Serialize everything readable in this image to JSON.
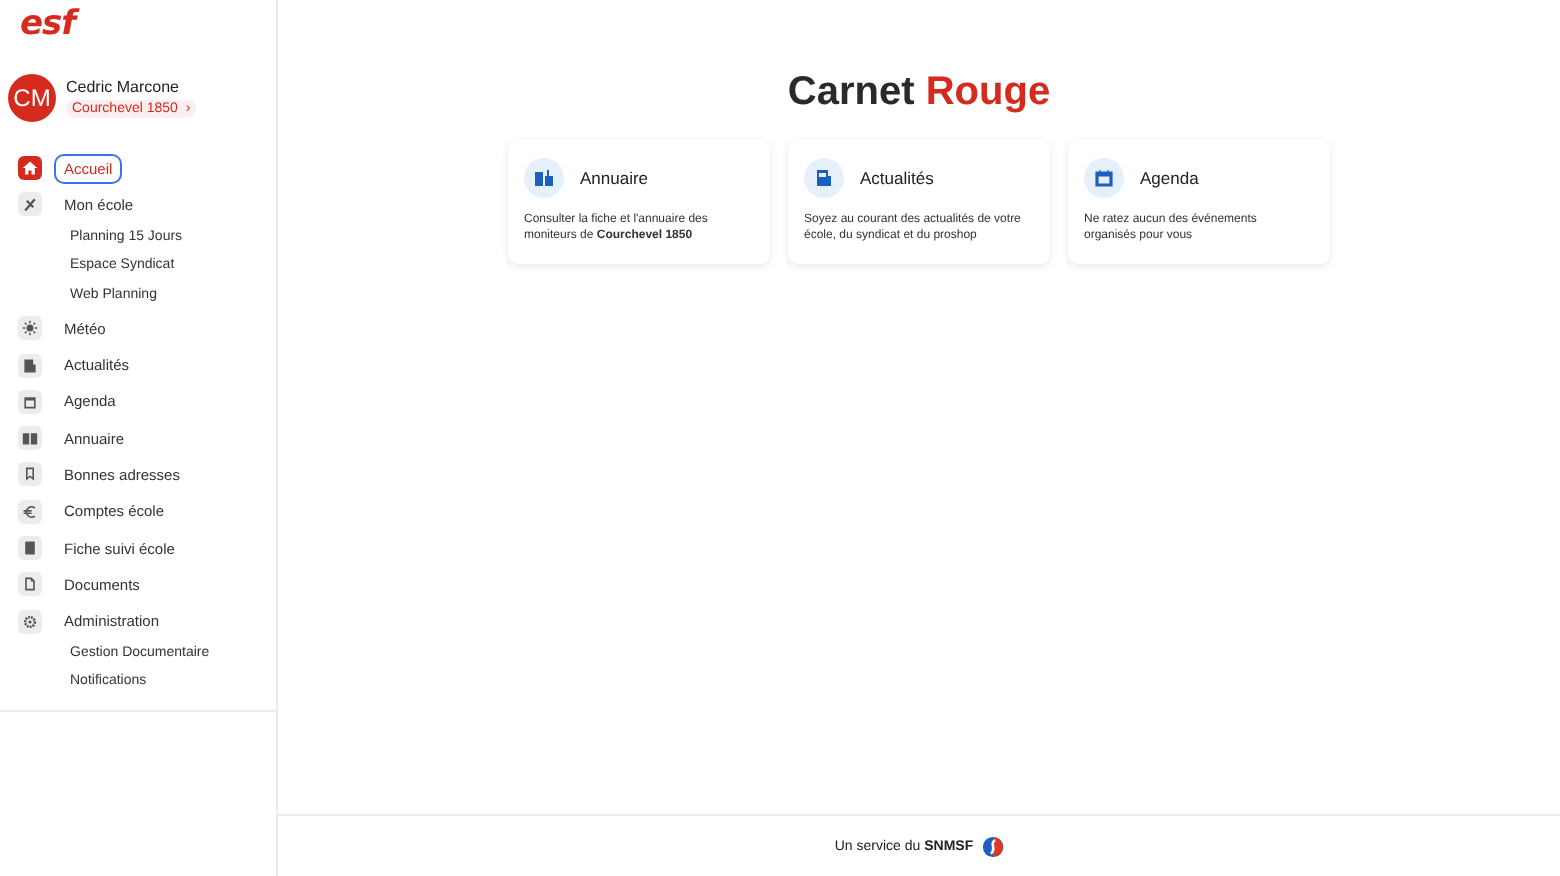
{
  "sidebar": {
    "logo": "esf",
    "user": {
      "initials": "CM",
      "name": "Cedric Marcone",
      "school": "Courchevel 1850",
      "chevron": "›"
    },
    "items": [
      {
        "label": "Accueil",
        "selected": true
      },
      {
        "label": "Mon école",
        "selected": false,
        "children": [
          {
            "label": "Planning 15 Jours"
          },
          {
            "label": "Espace Syndicat"
          },
          {
            "label": "Web Planning"
          }
        ]
      },
      {
        "label": "Météo",
        "selected": false
      },
      {
        "label": "Actualités",
        "selected": false
      },
      {
        "label": "Agenda",
        "selected": false
      },
      {
        "label": "Annuaire",
        "selected": false
      },
      {
        "label": "Bonnes adresses",
        "selected": false
      },
      {
        "label": "Comptes école",
        "selected": false
      },
      {
        "label": "Fiche suivi école",
        "selected": false
      },
      {
        "label": "Documents",
        "selected": false
      },
      {
        "label": "Administration",
        "selected": false,
        "children": [
          {
            "label": "Gestion Documentaire"
          },
          {
            "label": "Notifications"
          }
        ]
      }
    ]
  },
  "main": {
    "title": [
      {
        "text": "Carnet",
        "accent": false
      },
      {
        "text": "Rouge",
        "accent": true
      }
    ],
    "cards": [
      {
        "title": "Annuaire",
        "text": "Consulter la fiche et l'annuaire des moniteurs de **Courchevel 1850**"
      },
      {
        "title": "Actualités",
        "text": "Soyez au courant des actualités de votre école, du syndicat et du proshop"
      },
      {
        "title": "Agenda",
        "text": "Ne ratez aucun des événements organisés pour vous"
      }
    ]
  },
  "footer": {
    "text": "Un service du **SNMSF**"
  }
}
